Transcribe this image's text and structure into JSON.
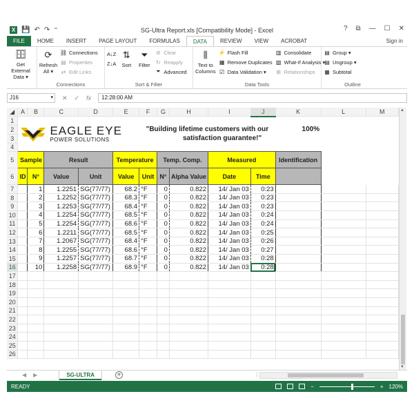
{
  "window": {
    "title": "SG-Ultra Report.xls  [Compatibility Mode] - Excel",
    "help": "?",
    "restore": "⧉",
    "minimize": "—",
    "maximize": "☐",
    "close": "✕"
  },
  "quick_access": {
    "save": "💾",
    "undo": "↶",
    "redo": "↷",
    "customize": "⁼"
  },
  "tabs": [
    "FILE",
    "HOME",
    "INSERT",
    "PAGE LAYOUT",
    "FORMULAS",
    "DATA",
    "REVIEW",
    "VIEW",
    "ACROBAT"
  ],
  "active_tab": "DATA",
  "sign_in": "Sign in",
  "ribbon": {
    "get_external": "Get External Data ▾",
    "refresh": "Refresh All ▾",
    "connections": "Connections",
    "properties": "Properties",
    "edit_links": "Edit Links",
    "group_connections": "Connections",
    "sort_az": "A↓Z",
    "sort_za": "Z↓A",
    "sort": "Sort",
    "filter": "Filter",
    "clear": "Clear",
    "reapply": "Reapply",
    "advanced": "Advanced",
    "group_sort": "Sort & Filter",
    "text_to_columns": "Text to Columns",
    "flash_fill": "Flash Fill",
    "remove_duplicates": "Remove Duplicates",
    "data_validation": "Data Validation ▾",
    "consolidate": "Consolidate",
    "what_if": "What-If Analysis ▾",
    "relationships": "Relationships",
    "group_data_tools": "Data Tools",
    "group_btn": "Group ▾",
    "ungroup_btn": "Ungroup ▾",
    "subtotal": "Subtotal",
    "group_outline": "Outline"
  },
  "formula_bar": {
    "name_box": "J16",
    "fx": "fx",
    "value": "12:28:00 AM"
  },
  "columns": [
    "A",
    "B",
    "C",
    "D",
    "E",
    "F",
    "G",
    "H",
    "I",
    "J",
    "K",
    "L",
    "M"
  ],
  "selected_cell": "J16",
  "header": {
    "logo_name": "EAGLE EYE",
    "logo_sub": "POWER SOLUTIONS",
    "slogan_1": "\"Building lifetime customers with our",
    "slogan_2": "satisfaction guarantee!\"",
    "percent": "100%"
  },
  "table_headers": {
    "sample": "Sample",
    "result": "Result",
    "temperature": "Temperature",
    "temp_comp": "Temp. Comp.",
    "measured": "Measured",
    "identification": "Identification",
    "id": "ID",
    "n": "N°",
    "value": "Value",
    "unit": "Unit",
    "t_value": "Value",
    "t_unit": "Unit",
    "tc_n": "N°",
    "alpha": "Alpha Value",
    "date": "Date",
    "time": "Time"
  },
  "rows": [
    {
      "n": "1",
      "value": "1.2251",
      "unit": "SG(77/77)",
      "temp": "68.2",
      "tunit": "°F",
      "tcn": "0",
      "alpha": "0.822",
      "date": "14/ Jan 03",
      "time": "0:23"
    },
    {
      "n": "2",
      "value": "1.2252",
      "unit": "SG(77/77)",
      "temp": "68.3",
      "tunit": "°F",
      "tcn": "0",
      "alpha": "0.822",
      "date": "14/ Jan 03",
      "time": "0:23"
    },
    {
      "n": "3",
      "value": "1.2253",
      "unit": "SG(77/77)",
      "temp": "68.4",
      "tunit": "°F",
      "tcn": "0",
      "alpha": "0.822",
      "date": "14/ Jan 03",
      "time": "0:23"
    },
    {
      "n": "4",
      "value": "1.2254",
      "unit": "SG(77/77)",
      "temp": "68.5",
      "tunit": "°F",
      "tcn": "0",
      "alpha": "0.822",
      "date": "14/ Jan 03",
      "time": "0:24"
    },
    {
      "n": "5",
      "value": "1.2254",
      "unit": "SG(77/77)",
      "temp": "68.6",
      "tunit": "°F",
      "tcn": "0",
      "alpha": "0.822",
      "date": "14/ Jan 03",
      "time": "0:24"
    },
    {
      "n": "6",
      "value": "1.2211",
      "unit": "SG(77/77)",
      "temp": "68.5",
      "tunit": "°F",
      "tcn": "0",
      "alpha": "0.822",
      "date": "14/ Jan 03",
      "time": "0:25"
    },
    {
      "n": "7",
      "value": "1.2067",
      "unit": "SG(77/77)",
      "temp": "68.4",
      "tunit": "°F",
      "tcn": "0",
      "alpha": "0.822",
      "date": "14/ Jan 03",
      "time": "0:26"
    },
    {
      "n": "8",
      "value": "1.2255",
      "unit": "SG(77/77)",
      "temp": "68.6",
      "tunit": "°F",
      "tcn": "0",
      "alpha": "0.822",
      "date": "14/ Jan 03",
      "time": "0:27"
    },
    {
      "n": "9",
      "value": "1.2257",
      "unit": "SG(77/77)",
      "temp": "68.7",
      "tunit": "°F",
      "tcn": "0",
      "alpha": "0.822",
      "date": "14/ Jan 03",
      "time": "0:28"
    },
    {
      "n": "10",
      "value": "1.2258",
      "unit": "SG(77/77)",
      "temp": "68.9",
      "tunit": "°F",
      "tcn": "0",
      "alpha": "0.822",
      "date": "14/ Jan 03",
      "time": "0:28"
    }
  ],
  "row_numbers": [
    "1",
    "2",
    "3",
    "4",
    "5",
    "6",
    "7",
    "8",
    "9",
    "10",
    "11",
    "12",
    "13",
    "14",
    "15",
    "16",
    "17",
    "18",
    "19",
    "20",
    "21",
    "22",
    "23",
    "24",
    "25",
    "26"
  ],
  "sheet": {
    "tab": "SG-ULTRA",
    "add": "+",
    "prev": "◀",
    "next": "▶",
    "more": "⋮"
  },
  "status": {
    "ready": "READY",
    "zoom": "120%",
    "minus": "−",
    "plus": "+"
  },
  "colors": {
    "excel_green": "#217346",
    "header_yellow": "#ffff00",
    "header_gray": "#b7b7b7"
  }
}
